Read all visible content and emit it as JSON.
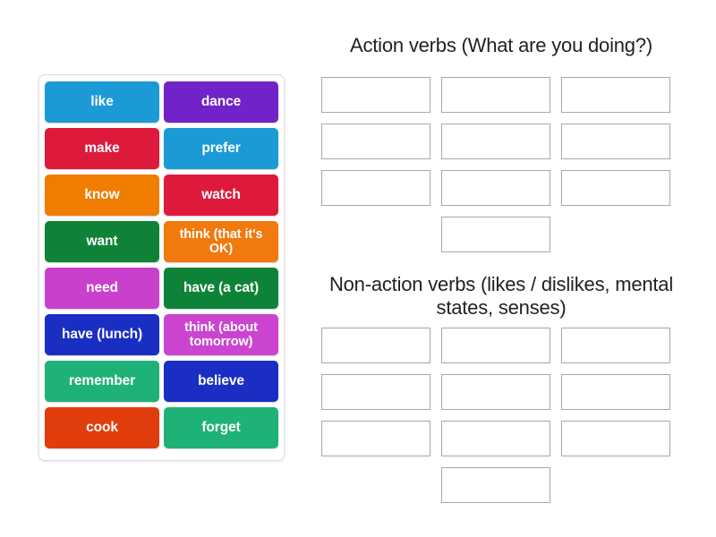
{
  "activity": {
    "type": "group-sort",
    "tile_text_color": "#ffffff"
  },
  "word_tiles": [
    {
      "label": "like",
      "color": "#1c9ad6",
      "lines": 1
    },
    {
      "label": "dance",
      "color": "#7122c8",
      "lines": 1
    },
    {
      "label": "make",
      "color": "#de1a3c",
      "lines": 1
    },
    {
      "label": "prefer",
      "color": "#1c9ad6",
      "lines": 1
    },
    {
      "label": "know",
      "color": "#f07c00",
      "lines": 1
    },
    {
      "label": "watch",
      "color": "#de1a3c",
      "lines": 1
    },
    {
      "label": "want",
      "color": "#0e8338",
      "lines": 1
    },
    {
      "label": "think (that it's OK)",
      "color": "#f2790d",
      "lines": 2
    },
    {
      "label": "need",
      "color": "#c940cc",
      "lines": 1
    },
    {
      "label": "have (a cat)",
      "color": "#0e8338",
      "lines": 1
    },
    {
      "label": "have (lunch)",
      "color": "#1a2ec4",
      "lines": 1
    },
    {
      "label": "think (about tomorrow)",
      "color": "#cb44cf",
      "lines": 2
    },
    {
      "label": "remember",
      "color": "#1fb276",
      "lines": 1
    },
    {
      "label": "believe",
      "color": "#1a2ec4",
      "lines": 1
    },
    {
      "label": "cook",
      "color": "#e03c0c",
      "lines": 1
    },
    {
      "label": "forget",
      "color": "#1fb276",
      "lines": 1
    }
  ],
  "groups": [
    {
      "heading": "Action verbs (What are you doing?)",
      "dropzones": [
        "",
        "",
        "",
        "",
        "",
        "",
        "",
        "",
        "",
        ""
      ]
    },
    {
      "heading": "Non-action verbs (likes / dislikes, mental states, senses)",
      "dropzones": [
        "",
        "",
        "",
        "",
        "",
        "",
        "",
        "",
        "",
        ""
      ]
    }
  ]
}
